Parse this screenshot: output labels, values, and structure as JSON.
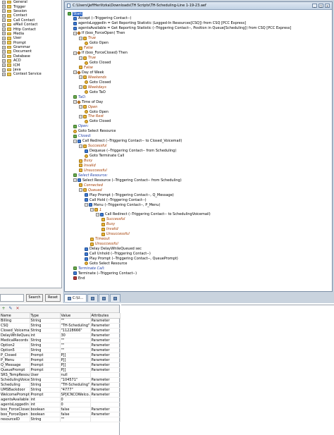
{
  "palette": {
    "items": [
      "General",
      "Trigger",
      "Session",
      "Contact",
      "Call Contact",
      "eMail Contact",
      "Http Contact",
      "Media",
      "User",
      "Prompt",
      "Grammar",
      "Document",
      "Database",
      "ACD",
      "ICM",
      "Java",
      "Context Service"
    ],
    "search_button": "Search",
    "reset_button": "Reset",
    "search_placeholder": ""
  },
  "script_window": {
    "title": "C:\\Users\\JeffHerlitzka\\Downloads\\TH Scripts\\TH-Scheduling-Line 1-19-23.aef",
    "tab_label": "C:\\U..."
  },
  "tree_nodes": [
    "Start",
    "Accept (--Triggering Contact--)",
    "agentsLoggedIn = Get Reporting Statistic (Logged-In Resources[CSQ]) from CSQ [PCC Express]",
    "agentsAvailable = Get Reporting Statistic (--Triggering Contact--, Position in Queue[Scheduling]) from CSQ [PCC Express]",
    "If (boo_ForceOpen) Then",
    "True",
    "Goto Open",
    "False",
    "If (boo_ForceClosed) Then",
    "True",
    "Goto Closed",
    "False",
    "Day of Week",
    "Weekends",
    "Goto Closed",
    "Weekdays",
    "Goto TaO",
    "TaO:",
    "Time of Day",
    "Open",
    "Goto Open",
    "The Rest",
    "Goto Closed",
    "Open:",
    "Goto Select Resource",
    "Closed:",
    "Call Redirect (--Triggering Contact-- to Closed_Voicemail)",
    "Successful",
    "Dequeue (--Triggering Contact-- from Scheduling)",
    "Goto Terminate Call",
    "Busy",
    "Invalid",
    "Unsuccessful",
    "Select Resource:",
    "Select Resource (--Triggering Contact-- from Scheduling)",
    "Connected",
    "Queued",
    "Play Prompt (--Triggering Contact--, Q_Message)",
    "Call Hold (--Triggering Contact--)",
    "Menu (--Triggering Contact--, P_Menu)",
    "1",
    "Call Redirect (--Triggering Contact-- to SchedulingVoicemail)",
    "Successful",
    "Busy",
    "Invalid",
    "Unsuccessful",
    "Timeout",
    "Unsuccessful",
    "Delay DelayWhileQueued sec",
    "Call Unhold (--Triggering Contact--)",
    "Play Prompt (--Triggering Contact--, QueuePrompt)",
    "Goto Select Resource",
    "Terminate Call:",
    "Terminate (--Triggering Contact--)",
    "End"
  ],
  "variables": {
    "headers": [
      "Name",
      "Type",
      "Value",
      "Attributes"
    ],
    "rows": [
      [
        "Billing",
        "String",
        "\"\"",
        "Parameter"
      ],
      [
        "CSQ",
        "String",
        "\"TH-Scheduling\"",
        "Parameter"
      ],
      [
        "Closed_Voicemail",
        "String",
        "\"11228666\"",
        "Parameter"
      ],
      [
        "DelayWhileQueued",
        "int",
        "30",
        "Parameter"
      ],
      [
        "MedicalRecords",
        "String",
        "\"\"",
        "Parameter"
      ],
      [
        "Option2",
        "String",
        "\"\"",
        "Parameter"
      ],
      [
        "Option5",
        "String",
        "\"\"",
        "Parameter"
      ],
      [
        "P_Closed",
        "Prompt",
        "P[]",
        "Parameter"
      ],
      [
        "P_Menu",
        "Prompt",
        "P[]",
        "Parameter"
      ],
      [
        "Q_Message",
        "Prompt",
        "P[]",
        "Parameter"
      ],
      [
        "QueuePrompt",
        "Prompt",
        "P[]",
        "Parameter"
      ],
      [
        "SRS_TempResou...",
        "User",
        "null",
        ""
      ],
      [
        "SchedulingVoice...",
        "String",
        "\"104571\"",
        "Parameter"
      ],
      [
        "Scheduling",
        "String",
        "\"TH-Scheduling\"",
        "Parameter"
      ],
      [
        "UMSBackdoor",
        "String",
        "\"4777\"",
        "Parameter"
      ],
      [
        "WelcomePrompt",
        "Prompt",
        "SP[ICNCOWelco...",
        "Parameter"
      ],
      [
        "agentsAvailable",
        "int",
        "0",
        ""
      ],
      [
        "agentsLoggedIn",
        "int",
        "0",
        ""
      ],
      [
        "boo_ForceClosed",
        "boolean",
        "false",
        "Parameter"
      ],
      [
        "boo_ForceOpen",
        "boolean",
        "false",
        "Parameter"
      ],
      [
        "resourceID",
        "String",
        "\"\"",
        ""
      ]
    ]
  },
  "colors": {
    "highlight": "#3169c6",
    "branch_text": "#a33b00",
    "label_text": "#1f3fa8"
  }
}
